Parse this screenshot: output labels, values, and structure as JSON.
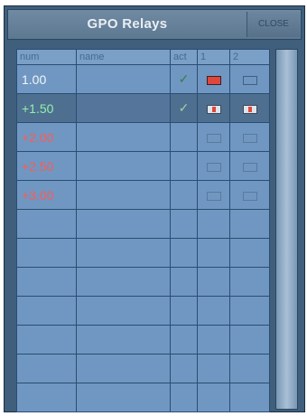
{
  "window": {
    "title": "GPO Relays",
    "close_label": "CLOSE"
  },
  "table": {
    "headers": {
      "num": "num",
      "name": "name",
      "act": "act",
      "r1": "1",
      "r2": "2"
    },
    "rows": [
      {
        "num": "1.00",
        "name": "",
        "act": "✓",
        "r1": "on",
        "r2": "off",
        "num_color": "white"
      },
      {
        "num": "+1.50",
        "name": "",
        "act": "✓",
        "r1": "pulse",
        "r2": "pulse",
        "num_color": "green",
        "selected": true
      },
      {
        "num": "+2.00",
        "name": "",
        "act": "",
        "r1": "off",
        "r2": "off",
        "num_color": "red"
      },
      {
        "num": "+2.50",
        "name": "",
        "act": "",
        "r1": "off",
        "r2": "off",
        "num_color": "red"
      },
      {
        "num": "+3.00",
        "name": "",
        "act": "",
        "r1": "off",
        "r2": "off",
        "num_color": "red"
      }
    ],
    "empty_rows": 7
  },
  "colors": {
    "window": "#3f5f7c",
    "grid": "#6f97c1",
    "text_white": "#f2f6fa",
    "text_green": "#8ff0a8",
    "text_red": "#ff5a55",
    "relay_on": "#e0473c"
  }
}
